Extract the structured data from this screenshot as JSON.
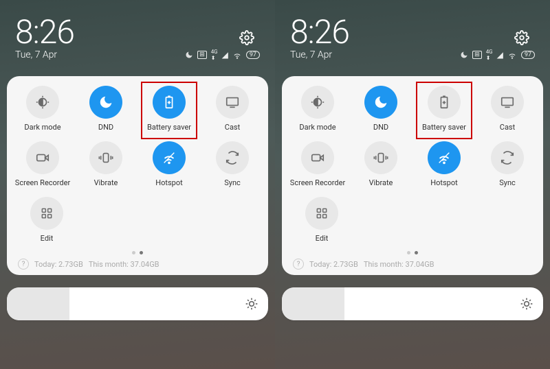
{
  "phones": [
    {
      "time": "8:26",
      "date": "Tue, 7 Apr",
      "battery": "97",
      "tiles": [
        {
          "name": "dark-mode",
          "label": "Dark mode",
          "on": false,
          "highlight": false
        },
        {
          "name": "dnd",
          "label": "DND",
          "on": true,
          "highlight": false
        },
        {
          "name": "battery-saver",
          "label": "Battery saver",
          "on": true,
          "highlight": true
        },
        {
          "name": "cast",
          "label": "Cast",
          "on": false,
          "highlight": false
        },
        {
          "name": "screen-recorder",
          "label": "Screen Recorder",
          "on": false,
          "highlight": false
        },
        {
          "name": "vibrate",
          "label": "Vibrate",
          "on": false,
          "highlight": false
        },
        {
          "name": "hotspot",
          "label": "Hotspot",
          "on": true,
          "highlight": false
        },
        {
          "name": "sync",
          "label": "Sync",
          "on": false,
          "highlight": false
        }
      ],
      "edit_label": "Edit",
      "data_today": "Today: 2.73GB",
      "data_month": "This month: 37.04GB"
    },
    {
      "time": "8:26",
      "date": "Tue, 7 Apr",
      "battery": "97",
      "tiles": [
        {
          "name": "dark-mode",
          "label": "Dark mode",
          "on": false,
          "highlight": false
        },
        {
          "name": "dnd",
          "label": "DND",
          "on": true,
          "highlight": false
        },
        {
          "name": "battery-saver",
          "label": "Battery saver",
          "on": false,
          "highlight": true
        },
        {
          "name": "cast",
          "label": "Cast",
          "on": false,
          "highlight": false
        },
        {
          "name": "screen-recorder",
          "label": "Screen Recorder",
          "on": false,
          "highlight": false
        },
        {
          "name": "vibrate",
          "label": "Vibrate",
          "on": false,
          "highlight": false
        },
        {
          "name": "hotspot",
          "label": "Hotspot",
          "on": true,
          "highlight": false
        },
        {
          "name": "sync",
          "label": "Sync",
          "on": false,
          "highlight": false
        }
      ],
      "edit_label": "Edit",
      "data_today": "Today: 2.73GB",
      "data_month": "This month: 37.04GB"
    }
  ],
  "icons": {
    "dark-mode": "darkmode",
    "dnd": "moon",
    "battery-saver": "batteryplus",
    "cast": "cast",
    "screen-recorder": "recorder",
    "vibrate": "vibrate",
    "hotspot": "hotspot",
    "sync": "sync",
    "edit": "grid"
  }
}
